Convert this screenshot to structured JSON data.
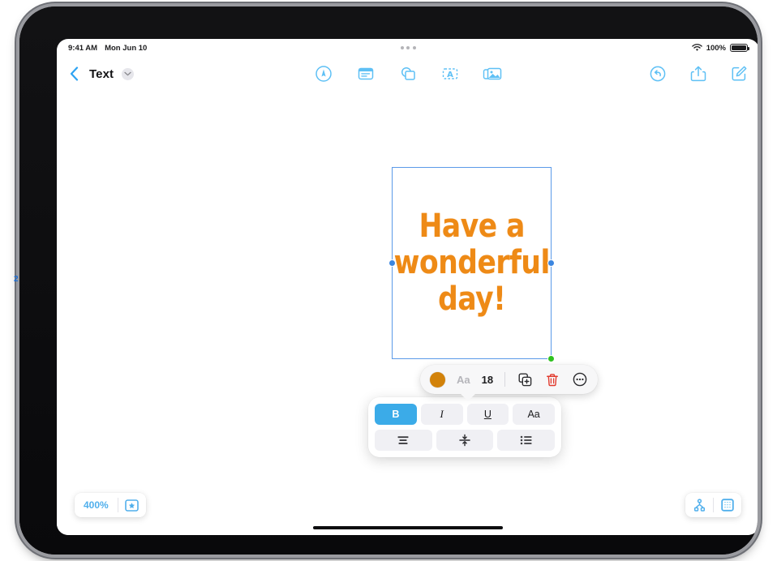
{
  "annotation": {
    "marker": "2"
  },
  "status_bar": {
    "time": "9:41 AM",
    "date": "Mon Jun 10",
    "wifi_icon": "wifi-icon",
    "battery_percent": "100%",
    "battery_icon": "battery-full-icon",
    "multitask_icon": "multitasking-dots-icon"
  },
  "nav_bar": {
    "back_icon": "back-chevron-icon",
    "title": "Text",
    "title_chevron_icon": "chevron-down-icon",
    "center_tools": [
      {
        "name": "draw-tool",
        "icon": "pen-in-circle-icon"
      },
      {
        "name": "format-tool",
        "icon": "document-format-icon"
      },
      {
        "name": "shapes-tool",
        "icon": "shapes-icon"
      },
      {
        "name": "text-box-tool",
        "icon": "text-box-icon"
      },
      {
        "name": "media-tool",
        "icon": "media-photo-icon"
      }
    ],
    "right_tools": [
      {
        "name": "undo-button",
        "icon": "undo-circle-icon"
      },
      {
        "name": "share-button",
        "icon": "share-up-icon"
      },
      {
        "name": "compose-button",
        "icon": "compose-pencil-icon"
      }
    ]
  },
  "text_box": {
    "text": "Have a\nwonderful\nday!",
    "text_color": "#EE8A16",
    "border_color": "#5b9ae8",
    "handle_color": "#3b86e0",
    "resize_handle_color": "#2fc21f"
  },
  "context_bar": {
    "color_swatch": "#D2820A",
    "font_label": "Aa",
    "font_size": "18",
    "duplicate_icon": "duplicate-icon",
    "delete_icon": "trash-icon",
    "more_icon": "more-ellipsis-circle-icon"
  },
  "format_panel": {
    "row1": [
      {
        "name": "bold-button",
        "label": "B",
        "active": true
      },
      {
        "name": "italic-button",
        "label": "I",
        "active": false
      },
      {
        "name": "underline-button",
        "label": "U",
        "active": false
      },
      {
        "name": "font-style-button",
        "label": "Aa",
        "active": false
      }
    ],
    "row2": [
      {
        "name": "align-center-button",
        "icon": "align-center-icon"
      },
      {
        "name": "line-spacing-button",
        "icon": "vertical-align-icon"
      },
      {
        "name": "bullet-list-button",
        "icon": "bullet-list-icon"
      }
    ],
    "accent_color": "#3BABE8"
  },
  "zoom_pill": {
    "zoom_level": "400%",
    "zoom_color": "#50AFEC",
    "favorite_icon": "star-in-box-icon"
  },
  "view_pill": {
    "hierarchy_icon": "node-hierarchy-icon",
    "canvas_icon": "canvas-grid-icon"
  }
}
